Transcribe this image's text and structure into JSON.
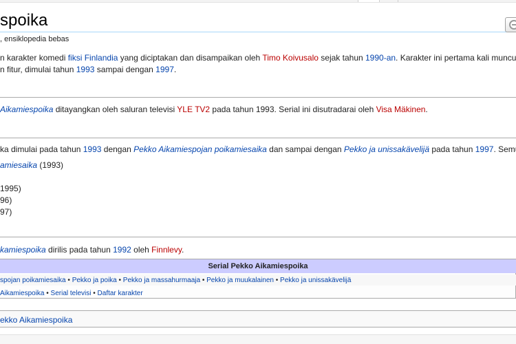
{
  "title": "spoika",
  "tagline": ", ensiklopedia bebas",
  "intro": {
    "l1_a": "n karakter komedi ",
    "l1_link1": "fiksi Finlandia",
    "l1_b": " yang diciptakan dan disampaikan oleh ",
    "l1_red1": "Timo Koivusalo",
    "l1_c": " sejak tahun ",
    "l1_link2": "1990-an",
    "l1_d": ". Karakter ini pertama kali muncul di televisi oleh saluran",
    "l2_a": "n fitur, dimulai tahun ",
    "l2_link1": "1993",
    "l2_b": " sampai dengan ",
    "l2_link2": "1997",
    "l2_c": "."
  },
  "tv": {
    "link1": "Aikamiespoika",
    "a": " ditayangkan oleh saluran televisi ",
    "red1": "YLE TV2",
    "b": " pada tahun 1993. Serial ini disutradarai oleh ",
    "red2": "Visa Mäkinen",
    "c": "."
  },
  "films": {
    "l1_a": "ka dimulai pada tahun ",
    "l1_link1": "1993",
    "l1_b": " dengan ",
    "l1_link2": "Pekko Aikamiespojan poikamiesaika",
    "l1_c": " dan sampai dengan ",
    "l1_link3": "Pekko ja unissakävelijä",
    "l1_d": " pada tahun ",
    "l1_link4": "1997",
    "l1_e": ". Semua film Pekko dibintan",
    "l2_link": "amiesaika",
    "l2_b": " (1993)",
    "l3": "1995)",
    "l4": "96)",
    "l5": "97)"
  },
  "music": {
    "link1": "kamiespoika",
    "a": " dirilis pada tahun ",
    "link2": "1992",
    "b": " oleh ",
    "red1": "Finnlevy",
    "c": "."
  },
  "navbox": {
    "title": "Serial Pekko Aikamiespoika",
    "row1": [
      "spojan poikamiesaika",
      "Pekko ja poika",
      "Pekko ja massahurmaaja",
      "Pekko ja muukalainen",
      "Pekko ja unissakävelijä"
    ],
    "row2": [
      "Aikamiespoika",
      "Serial televisi",
      "Daftar karakter"
    ],
    "separator": " • "
  },
  "category": "ekko Aikamiespoika"
}
